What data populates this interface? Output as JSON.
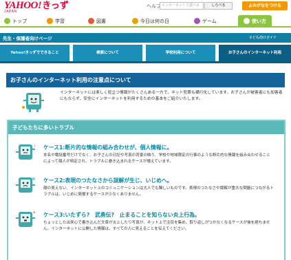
{
  "header": {
    "logo_main": "YAHOO!",
    "logo_sub": "JAPAN",
    "logo_kids": "きっず",
    "help": "ヘルプ",
    "search_placeholder": "インターネットで調べる",
    "search_button": "しらべる",
    "favorite_button": "よみがなをつける"
  },
  "nav": {
    "items": [
      {
        "label": "トップ",
        "color": "#8cc63f"
      },
      {
        "label": "学習",
        "color": "#f39800"
      },
      {
        "label": "図書",
        "color": "#e8563a"
      },
      {
        "label": "今日は何の日",
        "color": "#e8a200"
      },
      {
        "label": "ゲーム",
        "color": "#9b59b6"
      },
      {
        "label": "使い方",
        "color": "#ffffff"
      }
    ]
  },
  "breadcrumb": {
    "title": "先生・保護者向けページ",
    "guide_link": "子ども向けガイド"
  },
  "tabs": [
    {
      "label": "Yahoo!きっずでできること"
    },
    {
      "label": "検索について"
    },
    {
      "label": "学校利用について"
    },
    {
      "label": "お子さんのインターネット利用"
    }
  ],
  "main": {
    "heading": "お子さんのインターネット利用の注意点について",
    "intro": "インターネットには楽しく役立つ情報がたくさんある一方で、ネット犯罪も横行化しています。お子さんが被害者にも加害者にもならず、安全にインターネットを利用するための基本をご紹介いたします。"
  },
  "trouble": {
    "header": "子どもたちに多いトラブル",
    "cases": [
      {
        "title": "ケース1:断片的な情報の組み合わせが、個人情報に。",
        "desc": "本名や電話番号だけでなく、お子さんの日記や写真の背景の映り、学校や地域限定の行事のような断片的な情報を組み合わせることによって個人が特定され、トラブルに巻き込まれるケースが増えています。"
      },
      {
        "title": "ケース2:表現のつたなさから誤解が生じ、いじめへ。",
        "desc": "顔の見えない、インターネット上のコミュニケーションは大人でも難しいものです。表現のつたなさや誤解が重大な問題につながるトラブルは、いじめに発展するケースが少なくありません。"
      },
      {
        "title": "ケース3:いたずら?　武勇伝?　止まることを知らない炎上行為。",
        "desc": "ちょっとした出来心で書き込んだ文章が炎上したり写真が、ネット上で注目を集め、取り返しがつかなくなるケースが後を絶ちません。インターネットに公開した情報は、すべての人に見えることを伝えてください。"
      }
    ]
  }
}
